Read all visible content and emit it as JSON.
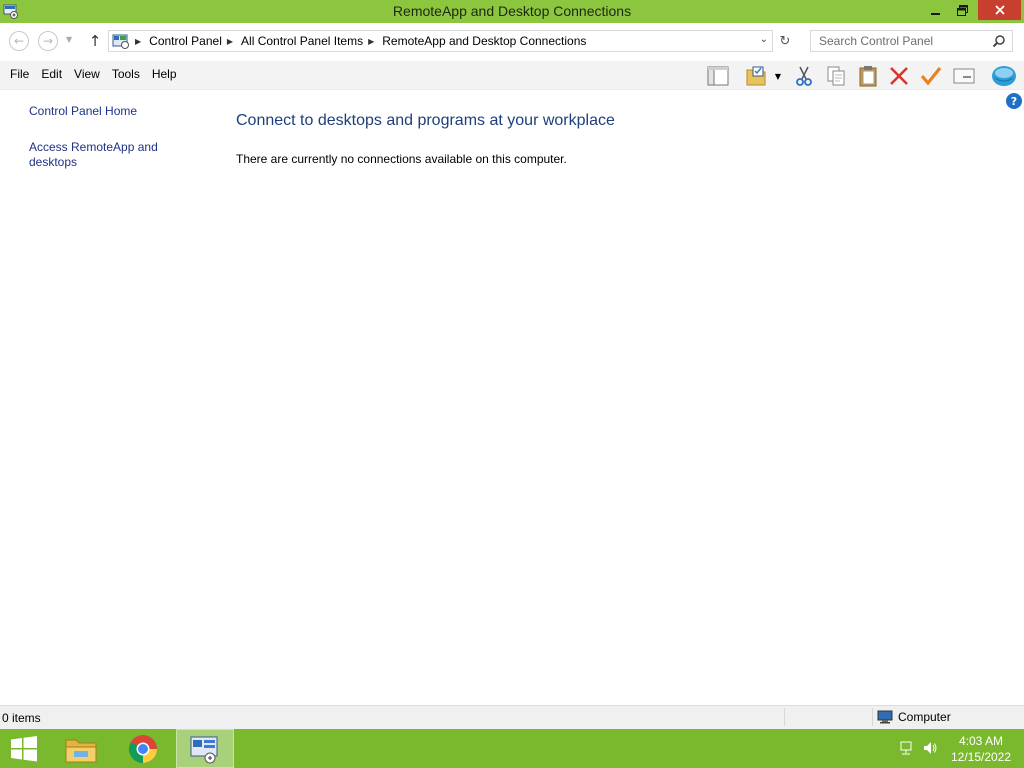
{
  "window": {
    "title": "RemoteApp and Desktop Connections",
    "controls": {
      "minimize": "—",
      "maximize": "❐",
      "close": "✕"
    }
  },
  "address": {
    "crumbs": [
      "Control Panel",
      "All Control Panel Items",
      "RemoteApp and Desktop Connections"
    ],
    "search_placeholder": "Search Control Panel"
  },
  "menu": {
    "file": "File",
    "edit": "Edit",
    "view": "View",
    "tools": "Tools",
    "help": "Help"
  },
  "toolbar": {
    "icons": [
      "layout-pane-icon",
      "folder-view-icon",
      "cut-icon",
      "copy-icon",
      "paste-icon",
      "delete-icon",
      "checkmark-icon",
      "properties-icon",
      "globe-icon"
    ]
  },
  "sidebar": {
    "items": [
      {
        "label": "Control Panel Home"
      },
      {
        "label": "Access RemoteApp and desktops"
      }
    ]
  },
  "main": {
    "heading": "Connect to desktops and programs at your workplace",
    "message": "There are currently no connections available on this computer."
  },
  "status": {
    "item_count": "0 items",
    "location": "Computer"
  },
  "taskbar": {
    "time": "4:03 AM",
    "date": "12/15/2022"
  },
  "colors": {
    "titlebar": "#8cc63f",
    "taskbar": "#7ab82d",
    "close_button": "#c7402f",
    "link": "#1e3287",
    "heading": "#1e3f7b"
  }
}
